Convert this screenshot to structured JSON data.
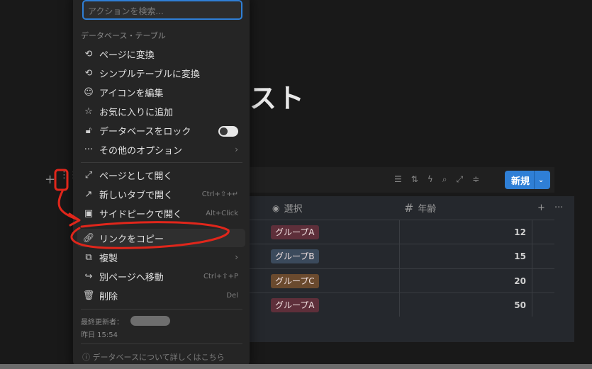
{
  "page": {
    "title": "スト"
  },
  "toolbar": {
    "new_label": "新規",
    "new_caret": "⌄"
  },
  "left_controls": {
    "add": "+",
    "drag": "⋮⋮"
  },
  "table": {
    "columns": [
      {
        "icon": "◉",
        "label": "選択"
      },
      {
        "icon": "#",
        "label": "年齢"
      }
    ],
    "header_actions": {
      "add": "+",
      "more": "···"
    },
    "rows": [
      {
        "tag": "グループA",
        "tag_color": "#5e2f3a",
        "age": "12"
      },
      {
        "tag": "グループB",
        "tag_color": "#3b4a5c",
        "age": "15"
      },
      {
        "tag": "グループC",
        "tag_color": "#6a4a2e",
        "age": "20"
      },
      {
        "tag": "グループA",
        "tag_color": "#5e2f3a",
        "age": "50"
      }
    ]
  },
  "menu": {
    "search_placeholder": "アクションを検索...",
    "section_label": "データベース・テーブル",
    "items": [
      {
        "label": "ページに変換"
      },
      {
        "label": "シンプルテーブルに変換"
      },
      {
        "label": "アイコンを編集"
      },
      {
        "label": "お気に入りに追加"
      },
      {
        "label": "データベースをロック"
      },
      {
        "label": "その他のオプション"
      },
      {
        "label": "ページとして開く"
      },
      {
        "label": "新しいタブで開く",
        "shortcut": "Ctrl+⇧+↵"
      },
      {
        "label": "サイドピークで開く",
        "shortcut": "Alt+Click"
      },
      {
        "label": "リンクをコピー"
      },
      {
        "label": "複製"
      },
      {
        "label": "別ページへ移動",
        "shortcut": "Ctrl+⇧+P"
      },
      {
        "label": "削除",
        "shortcut": "Del"
      }
    ],
    "last_edited_label": "最終更新者：",
    "last_edited_time": "昨日 15:54",
    "footer": "データベースについて詳しくはこちら"
  },
  "colors": {
    "accent": "#2f7fd6",
    "annotation": "#e0261b"
  }
}
